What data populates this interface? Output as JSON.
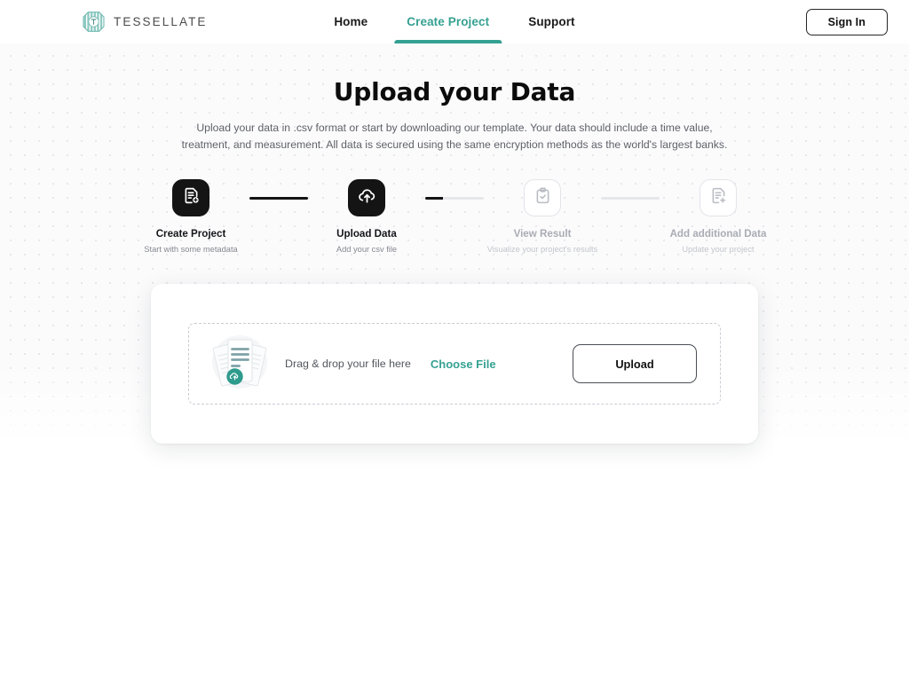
{
  "header": {
    "logo_icon": "tessellate-hex-logo",
    "brand_name": "TESSELLATE",
    "nav": [
      {
        "label": "Home",
        "active": false
      },
      {
        "label": "Create Project",
        "active": true
      },
      {
        "label": "Support",
        "active": false
      }
    ],
    "signin_label": "Sign In"
  },
  "hero": {
    "title": "Upload your Data",
    "subtitle": "Upload your data in .csv format or start by downloading our template. Your data should include a time value, treatment, and measurement. All data is secured using the same encryption methods as the world's largest banks."
  },
  "stepper": {
    "steps": [
      {
        "label": "Create Project",
        "desc": "Start with some metadata",
        "icon": "document-plus-icon",
        "state": "done"
      },
      {
        "label": "Upload Data",
        "desc": "Add your csv file",
        "icon": "cloud-upload-icon",
        "state": "current"
      },
      {
        "label": "View Result",
        "desc": "Visualize your project's results",
        "icon": "clipboard-check-icon",
        "state": "todo"
      },
      {
        "label": "Add additional Data",
        "desc": "Update your project",
        "icon": "document-plus-icon",
        "state": "todo"
      }
    ],
    "connectors": [
      "full",
      "partial",
      "empty"
    ]
  },
  "upload": {
    "illustration_icon": "file-stack-cloud-upload-illustration",
    "drag_text": "Drag & drop your file here",
    "choose_file_label": "Choose File",
    "upload_button_label": "Upload"
  },
  "colors": {
    "accent_teal": "#35a192",
    "ink": "#141414",
    "muted": "#85888f",
    "disabled": "#c2c5cb",
    "dot_grid": "#e7e7ec"
  }
}
